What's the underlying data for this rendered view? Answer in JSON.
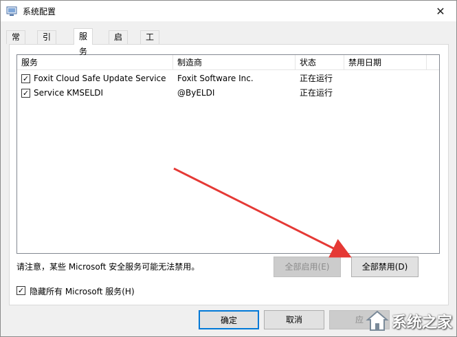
{
  "window": {
    "title": "系统配置"
  },
  "tabs": [
    {
      "label": "常规"
    },
    {
      "label": "引导"
    },
    {
      "label": "服务"
    },
    {
      "label": "启动"
    },
    {
      "label": "工具"
    }
  ],
  "services": {
    "columns": [
      "服务",
      "制造商",
      "状态",
      "禁用日期"
    ],
    "rows": [
      {
        "checked": true,
        "name": "Foxit Cloud Safe Update Service",
        "vendor": "Foxit Software Inc.",
        "status": "正在运行",
        "disabled_date": ""
      },
      {
        "checked": true,
        "name": "Service KMSELDI",
        "vendor": "@ByELDI",
        "status": "正在运行",
        "disabled_date": ""
      }
    ]
  },
  "notice": "请注意，某些 Microsoft 安全服务可能无法禁用。",
  "buttons": {
    "enable_all": "全部启用(E)",
    "disable_all": "全部禁用(D)"
  },
  "hide_microsoft": {
    "checked": true,
    "label": "隐藏所有 Microsoft 服务(H)"
  },
  "footer": {
    "ok": "确定",
    "cancel": "取消",
    "apply": "应"
  },
  "watermark": {
    "text": "系统之家"
  },
  "colors": {
    "arrow": "#e53935",
    "focus": "#0078d7"
  }
}
